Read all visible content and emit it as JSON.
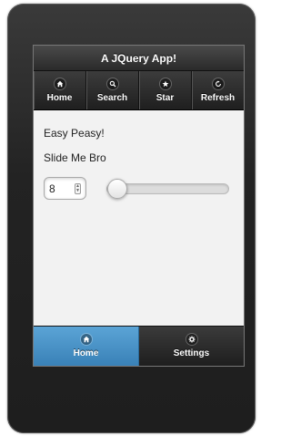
{
  "app": {
    "title": "A JQuery App!"
  },
  "navbar": {
    "items": [
      {
        "label": "Home",
        "icon": "home-icon"
      },
      {
        "label": "Search",
        "icon": "search-icon"
      },
      {
        "label": "Star",
        "icon": "star-icon"
      },
      {
        "label": "Refresh",
        "icon": "refresh-icon"
      }
    ]
  },
  "content": {
    "text1": "Easy Peasy!",
    "text2": "Slide Me Bro",
    "slider": {
      "value": "8",
      "level": 0.08
    }
  },
  "footer": {
    "tabs": [
      {
        "label": "Home",
        "icon": "home-icon",
        "active": true
      },
      {
        "label": "Settings",
        "icon": "gear-icon",
        "active": false
      }
    ]
  },
  "colors": {
    "active_tab": "#4a94cc",
    "bar_dark": "#2a2a2a",
    "content_bg": "#f2f2f2"
  }
}
